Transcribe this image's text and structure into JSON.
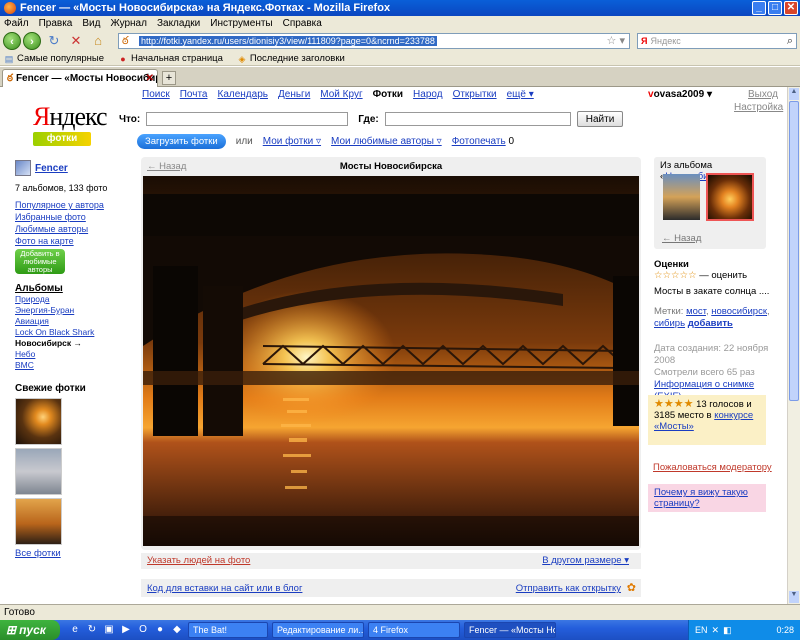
{
  "window": {
    "title": "Fencer — «Мосты Новосибирска» на Яндекс.Фотках - Mozilla Firefox"
  },
  "menu": [
    "Файл",
    "Правка",
    "Вид",
    "Журнал",
    "Закладки",
    "Инструменты",
    "Справка"
  ],
  "nav": {
    "url": "http://fotki.yandex.ru/users/dionisiy3/view/111809?page=0&ncrnd=233788",
    "search_placeholder": "Яндекс",
    "search_engine": "Я"
  },
  "bookmarks": [
    "Самые популярные",
    "Начальная страница",
    "Последние заголовки"
  ],
  "tab": {
    "label": "Fencer — «Мосты Новосибирска» н..."
  },
  "site": {
    "logo_main": "ндекс",
    "logo_y": "Я",
    "logo_sub": "фотки",
    "topnav": [
      "Поиск",
      "Почта",
      "Календарь",
      "Деньги",
      "Мой Круг",
      "Фотки",
      "Народ",
      "Открытки",
      "ещё ▾"
    ],
    "user_first": "v",
    "user_rest": "ovasa2009 ▾",
    "logout": "Выход",
    "settings": "Настройка",
    "search_what": "Что:",
    "search_where": "Где:",
    "find": "Найти",
    "upload": "Загрузить фотки",
    "or": "или",
    "my_photos": "Мои фотки ▿",
    "fav_authors": "Мои любимые авторы ▿",
    "print": "Фотопечать",
    "print_count": "0"
  },
  "sidebar": {
    "author": "Fencer",
    "stats": "7 альбомов, 133 фото",
    "links": [
      "Популярное у автора",
      "Избранные фото",
      "Любимые авторы",
      "Фото на карте"
    ],
    "fav_btn": "Добавить в любимые авторы",
    "albums_title": "Альбомы",
    "albums": [
      "Природа",
      "Энергия-Буран",
      "Авиация",
      "Lock On Black Shark",
      "Новосибирск →",
      "Небо",
      "ВМС"
    ],
    "fresh_title": "Свежие фотки",
    "all_photos": "Все фотки"
  },
  "photo": {
    "back": "← Назад",
    "title": "Мосты Новосибирска",
    "tag_people": "Указать людей на фото",
    "other_size": "В другом размере ▾",
    "embed": "Код для вставки на сайт или в блог",
    "send_card": "Отправить как открытку"
  },
  "right": {
    "from_album": "Из альбома «",
    "album_link": "Новосибирск",
    "album_close": "»",
    "back": "← Назад",
    "ratings_title": "Оценки",
    "stars_empty": "☆☆☆☆☆",
    "rate": "— оценить",
    "desc": "Мосты в закате солнца ....",
    "tags_label": "Метки:",
    "tags": [
      "мост",
      "новосибирск",
      "сибирь"
    ],
    "tags_add": "добавить",
    "created": "Дата создания: 22 ноября 2008",
    "views": "Смотрели всего 65 раз",
    "exif": "Информация о снимке (EXIF)",
    "votes_stars": "★★★★",
    "votes_text": "13 голосов и 3185 место в",
    "votes_link": "конкурсе «Мосты»",
    "complain": "Пожаловаться модератору",
    "why": "Почему я вижу такую страницу?"
  },
  "status": {
    "text": "Готово"
  },
  "taskbar": {
    "start": "пуск",
    "tasks": [
      "The Bat!",
      "Редактирование ли...",
      "4 Firefox",
      "Fencer — «Мосты Но..."
    ],
    "lang": "EN",
    "clock": "0:28"
  },
  "colors": {
    "link": "#1a3dc1",
    "brand_red": "#ee0000",
    "fotki_green": "#9bd000"
  }
}
